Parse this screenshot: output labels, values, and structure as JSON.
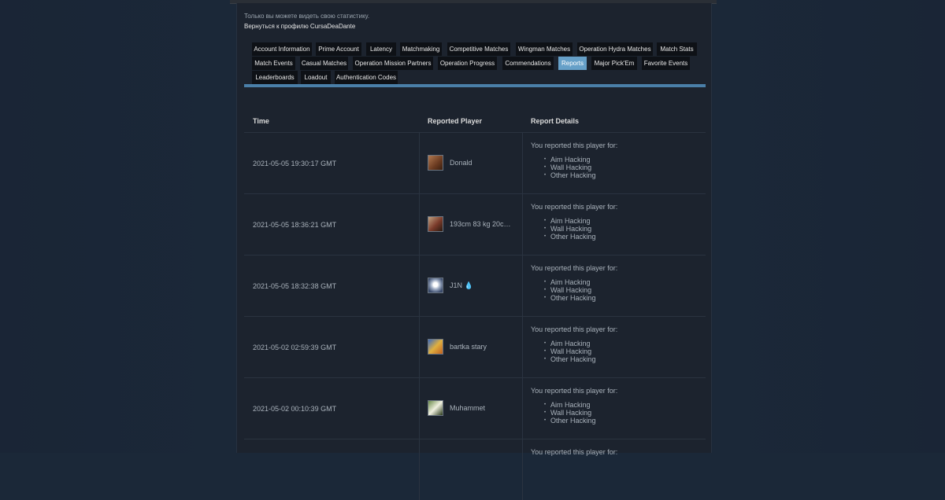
{
  "header": {
    "notice": "Только вы можете видеть свою статистику.",
    "back_link": "Вернуться к профилю CursaDeaDante"
  },
  "tabs": [
    {
      "label": "Account Information"
    },
    {
      "label": "Prime Account"
    },
    {
      "label": "Latency"
    },
    {
      "label": "Matchmaking"
    },
    {
      "label": "Competitive Matches"
    },
    {
      "label": "Wingman Matches"
    },
    {
      "label": "Operation Hydra Matches"
    },
    {
      "label": "Match Stats"
    },
    {
      "label": "Match Events"
    },
    {
      "label": "Casual Matches"
    },
    {
      "label": "Operation Mission Partners"
    },
    {
      "label": "Operation Progress"
    },
    {
      "label": "Commendations"
    },
    {
      "label": "Reports",
      "active": true
    },
    {
      "label": "Major Pick'Em"
    },
    {
      "label": "Favorite Events"
    },
    {
      "label": "Leaderboards"
    },
    {
      "label": "Loadout"
    },
    {
      "label": "Authentication Codes"
    }
  ],
  "table": {
    "headers": {
      "time": "Time",
      "player": "Reported Player",
      "details": "Report Details"
    },
    "rows": [
      {
        "time": "2021-05-05 19:30:17 GMT",
        "player": "Donald",
        "avatar_color": "#8a5a3a",
        "details_head": "You reported this player for:",
        "reasons": [
          "Aim Hacking",
          "Wall Hacking",
          "Other Hacking"
        ]
      },
      {
        "time": "2021-05-05 18:36:21 GMT",
        "player": "193cm 83 kg 20c…",
        "avatar_color": "#7a3a2a",
        "details_head": "You reported this player for:",
        "reasons": [
          "Aim Hacking",
          "Wall Hacking",
          "Other Hacking"
        ]
      },
      {
        "time": "2021-05-05 18:32:38 GMT",
        "player": "J1N 💧",
        "avatar_color": "#c8ccd4",
        "details_head": "You reported this player for:",
        "reasons": [
          "Aim Hacking",
          "Wall Hacking",
          "Other Hacking"
        ]
      },
      {
        "time": "2021-05-02 02:59:39 GMT",
        "player": "bartka stary",
        "avatar_color": "#d8a040",
        "details_head": "You reported this player for:",
        "reasons": [
          "Aim Hacking",
          "Wall Hacking",
          "Other Hacking"
        ]
      },
      {
        "time": "2021-05-02 00:10:39 GMT",
        "player": "Muhammet",
        "avatar_color": "#5a7a3a",
        "details_head": "You reported this player for:",
        "reasons": [
          "Aim Hacking",
          "Wall Hacking",
          "Other Hacking"
        ]
      },
      {
        "time": "",
        "player": "",
        "avatar_color": "",
        "details_head": "You reported this player for:",
        "reasons": []
      }
    ]
  },
  "colors": {
    "background": "#1b2838",
    "panel": "#1c232e",
    "tab_active": "#66a0c8",
    "tab_inactive": "#0e1116",
    "underline": "#4a7fa8"
  }
}
